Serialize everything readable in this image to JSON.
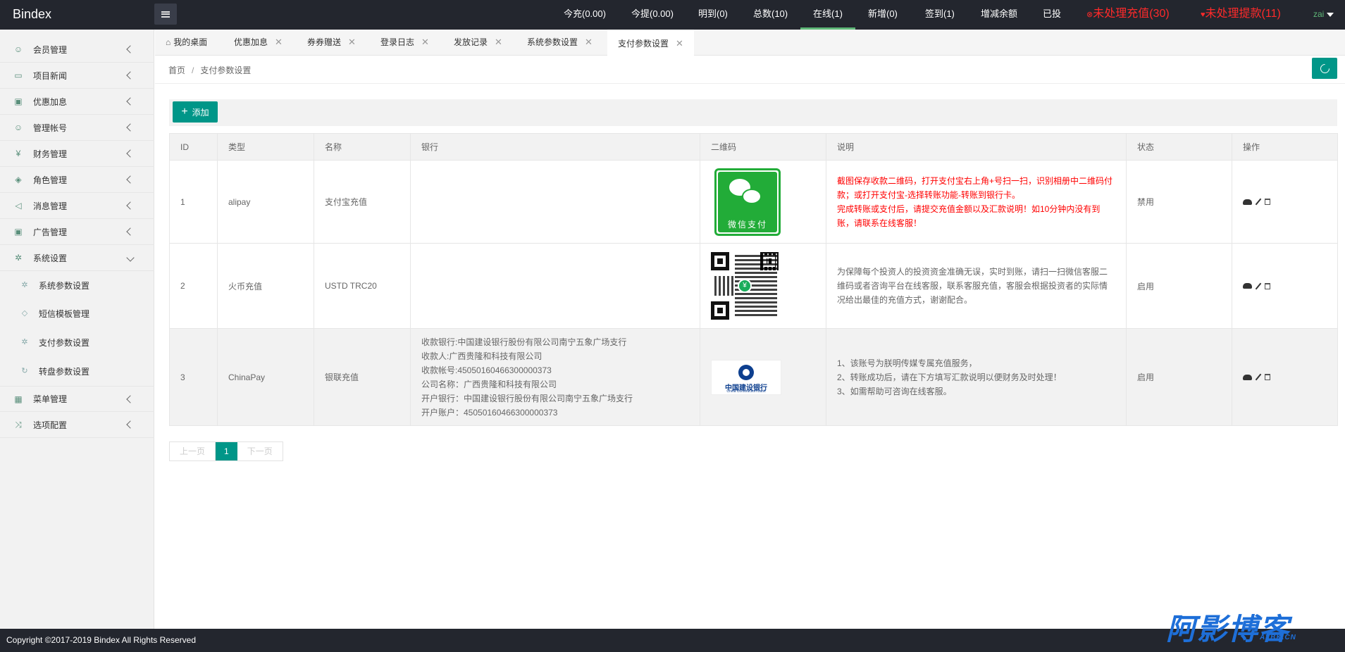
{
  "header": {
    "logo": "Bindex",
    "nav": [
      {
        "label": "今充(0.00)"
      },
      {
        "label": "今提(0.00)"
      },
      {
        "label": "明到(0)"
      },
      {
        "label": "总数(10)"
      },
      {
        "label": "在线(1)"
      },
      {
        "label": "新增(0)"
      },
      {
        "label": "签到(1)"
      },
      {
        "label": "增减余额"
      },
      {
        "label": "已投"
      }
    ],
    "alerts": [
      {
        "label": "未处理充值(30)"
      },
      {
        "label": "未处理提款(11)"
      }
    ],
    "user": "zai"
  },
  "sidebar": {
    "items": [
      {
        "label": "会员管理",
        "icon": "user-icon"
      },
      {
        "label": "项目新闻",
        "icon": "book-icon"
      },
      {
        "label": "优惠加息",
        "icon": "image-icon"
      },
      {
        "label": "管理帐号",
        "icon": "admin-icon"
      },
      {
        "label": "财务管理",
        "icon": "yen-icon"
      },
      {
        "label": "角色管理",
        "icon": "shield-icon"
      },
      {
        "label": "消息管理",
        "icon": "sound-icon"
      },
      {
        "label": "广告管理",
        "icon": "picture-icon"
      },
      {
        "label": "系统设置",
        "icon": "gear-icon"
      }
    ],
    "sub_items": [
      {
        "label": "系统参数设置",
        "icon": "gear-icon"
      },
      {
        "label": "短信模板管理",
        "icon": "tag-icon"
      },
      {
        "label": "支付参数设置",
        "icon": "key-icon"
      },
      {
        "label": "转盘参数设置",
        "icon": "refresh-icon"
      }
    ],
    "items2": [
      {
        "label": "菜单管理",
        "icon": "menu-icon"
      },
      {
        "label": "选项配置",
        "icon": "option-icon"
      }
    ]
  },
  "tabs": [
    {
      "label": "我的桌面"
    },
    {
      "label": "优惠加息"
    },
    {
      "label": "券券赠送"
    },
    {
      "label": "登录日志"
    },
    {
      "label": "发放记录"
    },
    {
      "label": "系统参数设置"
    },
    {
      "label": "支付参数设置"
    }
  ],
  "breadcrumb": {
    "home": "首页",
    "sep": "/",
    "current": "支付参数设置"
  },
  "toolbar": {
    "add_label": "添加",
    "add_icon": "plus-icon"
  },
  "table": {
    "headers": [
      "ID",
      "类型",
      "名称",
      "银行",
      "二维码",
      "说明",
      "状态",
      "操作"
    ],
    "rows": [
      {
        "id": "1",
        "type": "alipay",
        "name": "支付宝充值",
        "bank": [],
        "qr": "wechat-pay-qr",
        "qr_label": "微信支付",
        "desc": [
          "截图保存收款二维码，打开支付宝右上角+号扫一扫，识别相册中二维码付款；或打开支付宝-选择转账功能-转账到银行卡。",
          "完成转账或支付后，请提交充值金额以及汇款说明！如10分钟内没有到账，请联系在线客服！"
        ],
        "status": "禁用"
      },
      {
        "id": "2",
        "type": "火币充值",
        "name": "USTD TRC20",
        "bank": [],
        "qr": "qr-code",
        "desc": [
          "为保障每个投资人的投资资金准确无误，实时到账，请扫一扫微信客服二维码或者咨询平台在线客服，联系客服充值，客服会根据投资者的实际情况给出最佳的充值方式，谢谢配合。"
        ],
        "status": "启用"
      },
      {
        "id": "3",
        "type": "ChinaPay",
        "name": "银联充值",
        "bank": [
          "收款银行:中国建设银行股份有限公司南宁五象广场支行",
          "收款人:广西贵隆和科技有限公司",
          "收款帐号:45050160466300000373",
          "公司名称：广西贵隆和科技有限公司",
          "开户银行：中国建设银行股份有限公司南宁五象广场支行",
          "开户账户：45050160466300000373"
        ],
        "qr": "ccb-logo",
        "qr_cn": "中国建设银行",
        "qr_en": "China Construction Bank",
        "desc": [
          "1、该账号为朕明传媒专属充值服务，",
          "2、转账成功后，请在下方填写汇款说明以便财务及时处理！",
          "3、如需帮助可咨询在线客服。"
        ],
        "status": "启用"
      }
    ]
  },
  "pager": {
    "prev": "上一页",
    "current": "1",
    "next": "下一页"
  },
  "footer": {
    "text": "Copyright ©2017-2019 Bindex All Rights Reserved"
  },
  "watermark": {
    "main": "阿影博客",
    "sub": "AYBK.CN"
  },
  "colors": {
    "header_bg": "#23262e",
    "accent": "#009688",
    "active_green": "#5fb878",
    "alert_red": "#ff2a2a"
  }
}
